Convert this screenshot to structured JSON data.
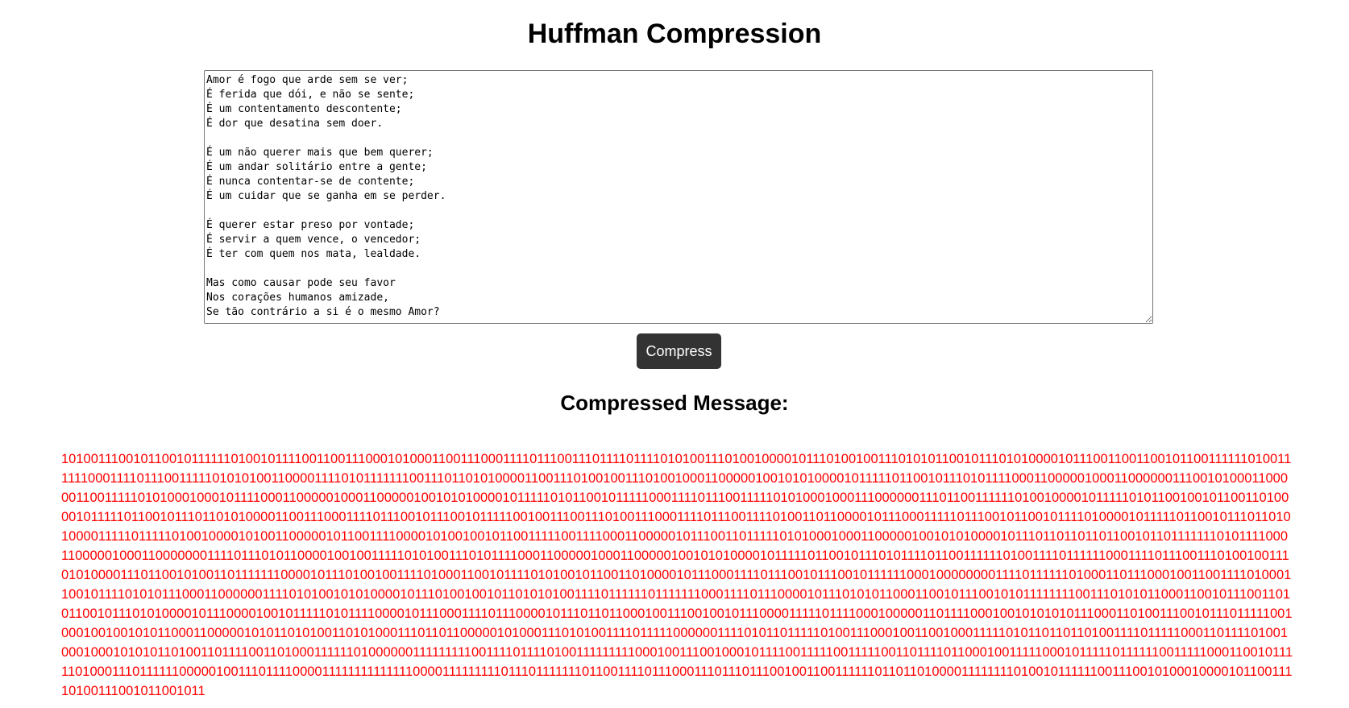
{
  "header": {
    "title": "Huffman Compression"
  },
  "input": {
    "text": "Amor é fogo que arde sem se ver;\nÉ ferida que dói, e não se sente;\nÉ um contentamento descontente;\nÉ dor que desatina sem doer.\n\nÉ um não querer mais que bem querer;\nÉ um andar solitário entre a gente;\nÉ nunca contentar-se de contente;\nÉ um cuidar que se ganha em se perder.\n\nÉ querer estar preso por vontade;\nÉ servir a quem vence, o vencedor;\nÉ ter com quem nos mata, lealdade.\n\nMas como causar pode seu favor\nNos corações humanos amizade,\nSe tão contrário a si é o mesmo Amor?"
  },
  "actions": {
    "compress_label": "Compress"
  },
  "result": {
    "heading": "Compressed Message:",
    "bits": "101001110010110010111111010010111100110011100010100011001110001111011100111011110111101010011101001000010111010010011101010110010111010100001011100110011001011001111110100111111000111101110011111010101001100001111010111111100111011010100001100111010010011101001000110000010010101000010111110110010111010111100011000001000110000001110010100011000001100111110101000100010111100011000001000110000010010101000010111110101100101111100011110111001111101010001000111000000111011001111110100100001011111010110010010110011010000101111101100101110110101000011001110001111011100101110010111110010011100111010011100011110111001111010011011000010111000111110111001011001011110100001011111011001011101101010000111110111110100100001010011000001011001111000010100100101100111110011110001100000101110011011111010100010001100000100101010000101110110110110110010110111111101011110001100000100011000000011110111010110000100100111110101001110101111000110000010001100000100101010000101111101100101110101111011001111110100111101111110001111011100111010010011101010000111011001010011011111110000101110100100111101000110010111101010010110011010000101110001111011100101110010111111000100000000111101111110100011011100010011001111010001100101111010101110001100000011110101001010100001011101001001011010101001111011111101111111000111101110000101110101011000110010111001010111111110011101010110001100101110011010110010111010100001011100001001011111010111100001011100011110111000010111011011000100111001001011100001111101111000100000110111100010010101010111000110100111001011101111100100010010010101100011000001010110101001101010001110110110000010100011101010011110111110000001111010110111110100111000100110010001111101011011011010011110111110001101111010010001000101010110100110111100110100011111101000000111111111001111011110100111111111000100111001000101111001111100111110011011110110001001111100010111110111111001111100011001011111010001110111111000001001110111100001111111111111100001111111110111011111110110011110111000111011101110010011001111110110110100001111111101001011111100111001010001000010110011110100111001011001011"
  }
}
